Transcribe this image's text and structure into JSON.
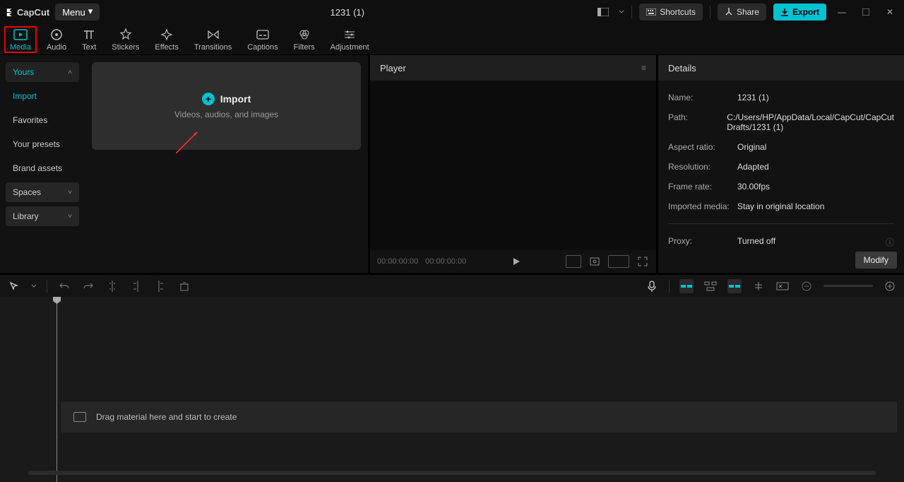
{
  "app": {
    "name": "CapCut",
    "menu": "Menu",
    "project_title": "1231 (1)"
  },
  "titlebar": {
    "shortcuts": "Shortcuts",
    "share": "Share",
    "export": "Export"
  },
  "tabs": [
    {
      "label": "Media"
    },
    {
      "label": "Audio"
    },
    {
      "label": "Text"
    },
    {
      "label": "Stickers"
    },
    {
      "label": "Effects"
    },
    {
      "label": "Transitions"
    },
    {
      "label": "Captions"
    },
    {
      "label": "Filters"
    },
    {
      "label": "Adjustment"
    }
  ],
  "sidebar": {
    "yours": "Yours",
    "import": "Import",
    "favorites": "Favorites",
    "presets": "Your presets",
    "brand": "Brand assets",
    "spaces": "Spaces",
    "library": "Library"
  },
  "importbox": {
    "title": "Import",
    "subtitle": "Videos, audios, and images"
  },
  "player": {
    "title": "Player",
    "time_current": "00:00:00:00",
    "time_total": "00:00:00:00"
  },
  "details": {
    "title": "Details",
    "rows": {
      "name_l": "Name:",
      "name_v": "1231 (1)",
      "path_l": "Path:",
      "path_v": "C:/Users/HP/AppData/Local/CapCut/CapCut Drafts/1231 (1)",
      "ratio_l": "Aspect ratio:",
      "ratio_v": "Original",
      "res_l": "Resolution:",
      "res_v": "Adapted",
      "fps_l": "Frame rate:",
      "fps_v": "30.00fps",
      "imp_l": "Imported media:",
      "imp_v": "Stay in original location",
      "proxy_l": "Proxy:",
      "proxy_v": "Turned off"
    },
    "modify": "Modify"
  },
  "timeline": {
    "drop_hint": "Drag material here and start to create"
  }
}
